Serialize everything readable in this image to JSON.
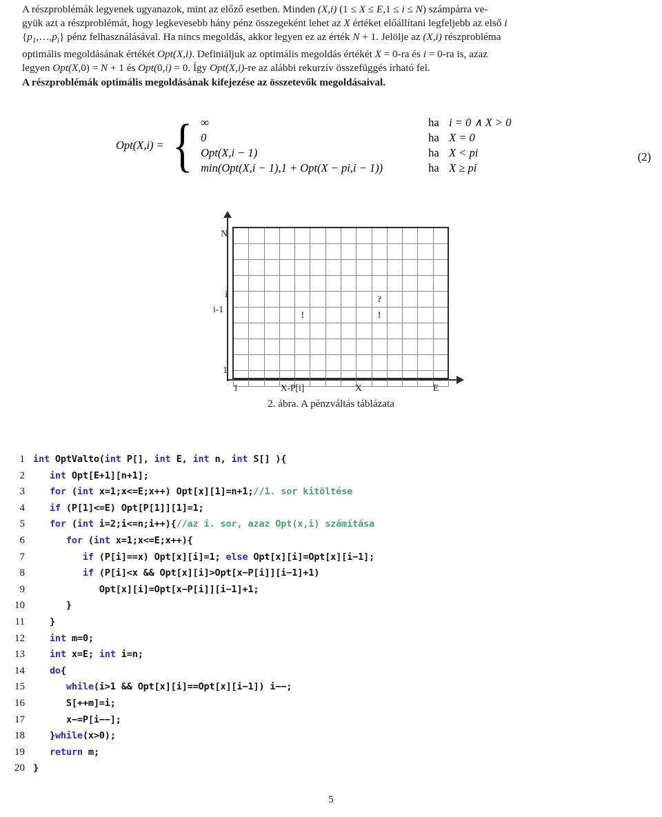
{
  "prose": {
    "lines": [
      "A részproblémák legyenek ugyanazok, mint az előző esetben. Minden (X,i) (1 ≤ X ≤ E,1 ≤ i ≤ N) számpárra ve-",
      "gyük azt a részproblémát, hogy legkevesebb hány pénz összegeként lehet az X értéket előállítani legfeljebb az első i",
      "{p1,…,pi} pénz felhasználásával. Ha nincs megoldás, akkor legyen ez az érték N + 1. Jelölje az (X,i) részprobléma",
      "optimális megoldásának értékét Opt(X,i). Definiáljuk az optimális megoldás értékét X = 0-ra és i = 0-ra is, azaz",
      "legyen Opt(X,0) = N + 1 és Opt(0,i) = 0. Így Opt(X,i)-re az alábbi rekurzív összefüggés írható fel."
    ],
    "bold_line": "A részproblémák optimális megoldásának kifejezése az összetevők megoldásaival."
  },
  "equation": {
    "lhs": "Opt(X,i) =",
    "number": "(2)",
    "rows": [
      {
        "value": "∞",
        "ha": "ha",
        "condition": "i = 0 ∧ X > 0"
      },
      {
        "value": "0",
        "ha": "ha",
        "condition": "X = 0"
      },
      {
        "value": "Opt(X,i − 1)",
        "ha": "ha",
        "condition": "X < pi"
      },
      {
        "value": "min(Opt(X,i − 1),1 + Opt(X − pi,i − 1))",
        "ha": "ha",
        "condition": "X ≥ pi"
      }
    ]
  },
  "figure": {
    "caption": "2. ábra.  A pénzváltás táblázata",
    "y_labels": [
      "N",
      "i",
      "i-1",
      "1"
    ],
    "x_labels": [
      "1",
      "X-P[i]",
      "X",
      "E"
    ],
    "grid": {
      "columns": 14,
      "rows": 10
    },
    "marks": [
      {
        "symbol": "?",
        "color": "#c0261b",
        "row_label": "i",
        "col_label": "X"
      },
      {
        "symbol": "!",
        "color": "#222277",
        "row_label": "i-1",
        "col_label": "X"
      },
      {
        "symbol": "!",
        "color": "#222277",
        "row_label": "i-1",
        "col_label": "X-P[i]"
      }
    ]
  },
  "code": {
    "lines": [
      {
        "n": "1",
        "tokens": [
          {
            "t": "int",
            "c": "kw"
          },
          {
            "t": " OptValto(",
            "c": ""
          },
          {
            "t": "int",
            "c": "kw"
          },
          {
            "t": " P[], ",
            "c": ""
          },
          {
            "t": "int",
            "c": "kw"
          },
          {
            "t": " E, ",
            "c": ""
          },
          {
            "t": "int",
            "c": "kw"
          },
          {
            "t": " n, ",
            "c": ""
          },
          {
            "t": "int",
            "c": "kw"
          },
          {
            "t": " S[] ){",
            "c": ""
          }
        ]
      },
      {
        "n": "2",
        "tokens": [
          {
            "t": "   ",
            "c": ""
          },
          {
            "t": "int",
            "c": "kw"
          },
          {
            "t": " Opt[E+1][n+1];",
            "c": ""
          }
        ]
      },
      {
        "n": "3",
        "tokens": [
          {
            "t": "   ",
            "c": ""
          },
          {
            "t": "for",
            "c": "kw"
          },
          {
            "t": " (",
            "c": ""
          },
          {
            "t": "int",
            "c": "kw"
          },
          {
            "t": " x=1;x<=E;x++) Opt[x][1]=n+1;",
            "c": ""
          },
          {
            "t": "//1. sor kitöltése",
            "c": "cm"
          }
        ]
      },
      {
        "n": "4",
        "tokens": [
          {
            "t": "   ",
            "c": ""
          },
          {
            "t": "if",
            "c": "kw"
          },
          {
            "t": " (P[1]<=E) Opt[P[1]][1]=1;",
            "c": ""
          }
        ]
      },
      {
        "n": "5",
        "tokens": [
          {
            "t": "   ",
            "c": ""
          },
          {
            "t": "for",
            "c": "kw"
          },
          {
            "t": " (",
            "c": ""
          },
          {
            "t": "int",
            "c": "kw"
          },
          {
            "t": " i=2;i<=n;i++){",
            "c": ""
          },
          {
            "t": "//az i. sor, azaz Opt(x,i) számítása",
            "c": "cm"
          }
        ]
      },
      {
        "n": "6",
        "tokens": [
          {
            "t": "      ",
            "c": ""
          },
          {
            "t": "for",
            "c": "kw"
          },
          {
            "t": " (",
            "c": ""
          },
          {
            "t": "int",
            "c": "kw"
          },
          {
            "t": " x=1;x<=E;x++){",
            "c": ""
          }
        ]
      },
      {
        "n": "7",
        "tokens": [
          {
            "t": "         ",
            "c": ""
          },
          {
            "t": "if",
            "c": "kw"
          },
          {
            "t": " (P[i]==x) Opt[x][i]=1; ",
            "c": ""
          },
          {
            "t": "else",
            "c": "kw"
          },
          {
            "t": " Opt[x][i]=Opt[x][i−1];",
            "c": ""
          }
        ]
      },
      {
        "n": "8",
        "tokens": [
          {
            "t": "         ",
            "c": ""
          },
          {
            "t": "if",
            "c": "kw"
          },
          {
            "t": " (P[i]<x && Opt[x][i]>Opt[x−P[i]][i−1]+1)",
            "c": ""
          }
        ]
      },
      {
        "n": "9",
        "tokens": [
          {
            "t": "            Opt[x][i]=Opt[x−P[i]][i−1]+1;",
            "c": ""
          }
        ]
      },
      {
        "n": "10",
        "tokens": [
          {
            "t": "      }",
            "c": ""
          }
        ]
      },
      {
        "n": "11",
        "tokens": [
          {
            "t": "   }",
            "c": ""
          }
        ]
      },
      {
        "n": "12",
        "tokens": [
          {
            "t": "   ",
            "c": ""
          },
          {
            "t": "int",
            "c": "kw"
          },
          {
            "t": " m=0;",
            "c": ""
          }
        ]
      },
      {
        "n": "13",
        "tokens": [
          {
            "t": "   ",
            "c": ""
          },
          {
            "t": "int",
            "c": "kw"
          },
          {
            "t": " x=E; ",
            "c": ""
          },
          {
            "t": "int",
            "c": "kw"
          },
          {
            "t": " i=n;",
            "c": ""
          }
        ]
      },
      {
        "n": "14",
        "tokens": [
          {
            "t": "   ",
            "c": ""
          },
          {
            "t": "do",
            "c": "kw"
          },
          {
            "t": "{",
            "c": ""
          }
        ]
      },
      {
        "n": "15",
        "tokens": [
          {
            "t": "      ",
            "c": ""
          },
          {
            "t": "while",
            "c": "kw"
          },
          {
            "t": "(i>1 && Opt[x][i]==Opt[x][i−1]) i−−;",
            "c": ""
          }
        ]
      },
      {
        "n": "16",
        "tokens": [
          {
            "t": "      S[++m]=i;",
            "c": ""
          }
        ]
      },
      {
        "n": "17",
        "tokens": [
          {
            "t": "      x−=P[i−−];",
            "c": ""
          }
        ]
      },
      {
        "n": "18",
        "tokens": [
          {
            "t": "   }",
            "c": ""
          },
          {
            "t": "while",
            "c": "kw"
          },
          {
            "t": "(x>0);",
            "c": ""
          }
        ]
      },
      {
        "n": "19",
        "tokens": [
          {
            "t": "   ",
            "c": ""
          },
          {
            "t": "return",
            "c": "kw"
          },
          {
            "t": " m;",
            "c": ""
          }
        ]
      },
      {
        "n": "20",
        "tokens": [
          {
            "t": "}",
            "c": ""
          }
        ]
      }
    ]
  },
  "page_number": "5"
}
